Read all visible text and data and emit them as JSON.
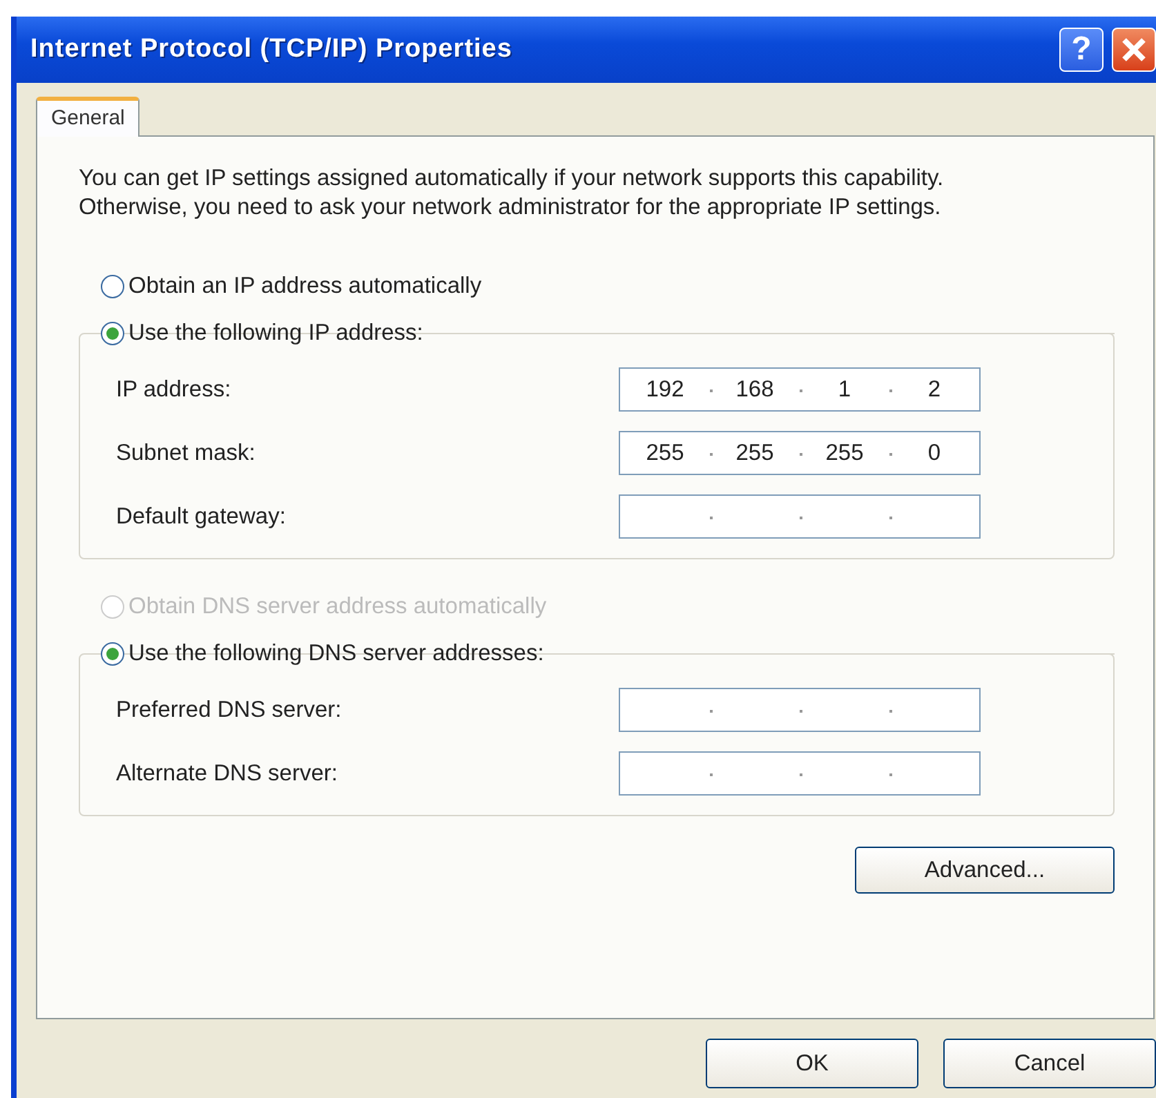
{
  "window": {
    "title": "Internet Protocol (TCP/IP) Properties",
    "help_button": "?"
  },
  "tabs": [
    {
      "label": "General",
      "selected": true
    }
  ],
  "intro": "You can get IP settings assigned automatically if your network supports this capability. Otherwise, you need to ask your network administrator for the appropriate IP settings.",
  "ip_group": {
    "options": [
      {
        "label": "Obtain an IP address automatically",
        "selected": false,
        "disabled": false
      },
      {
        "label": "Use the following IP address:",
        "selected": true,
        "disabled": false
      }
    ],
    "fields": [
      {
        "label": "IP address:",
        "octets": [
          "192",
          "168",
          "1",
          "2"
        ]
      },
      {
        "label": "Subnet mask:",
        "octets": [
          "255",
          "255",
          "255",
          "0"
        ]
      },
      {
        "label": "Default gateway:"
      }
    ]
  },
  "dns_group": {
    "options": [
      {
        "label": "Obtain DNS server address automatically",
        "selected": false,
        "disabled": true
      },
      {
        "label": "Use the following DNS server addresses:",
        "selected": true,
        "disabled": false
      }
    ],
    "fields": [
      {
        "label": "Preferred DNS server:"
      },
      {
        "label": "Alternate DNS server:"
      }
    ]
  },
  "advanced_button": "Advanced...",
  "buttons": [
    "OK",
    "Cancel"
  ]
}
